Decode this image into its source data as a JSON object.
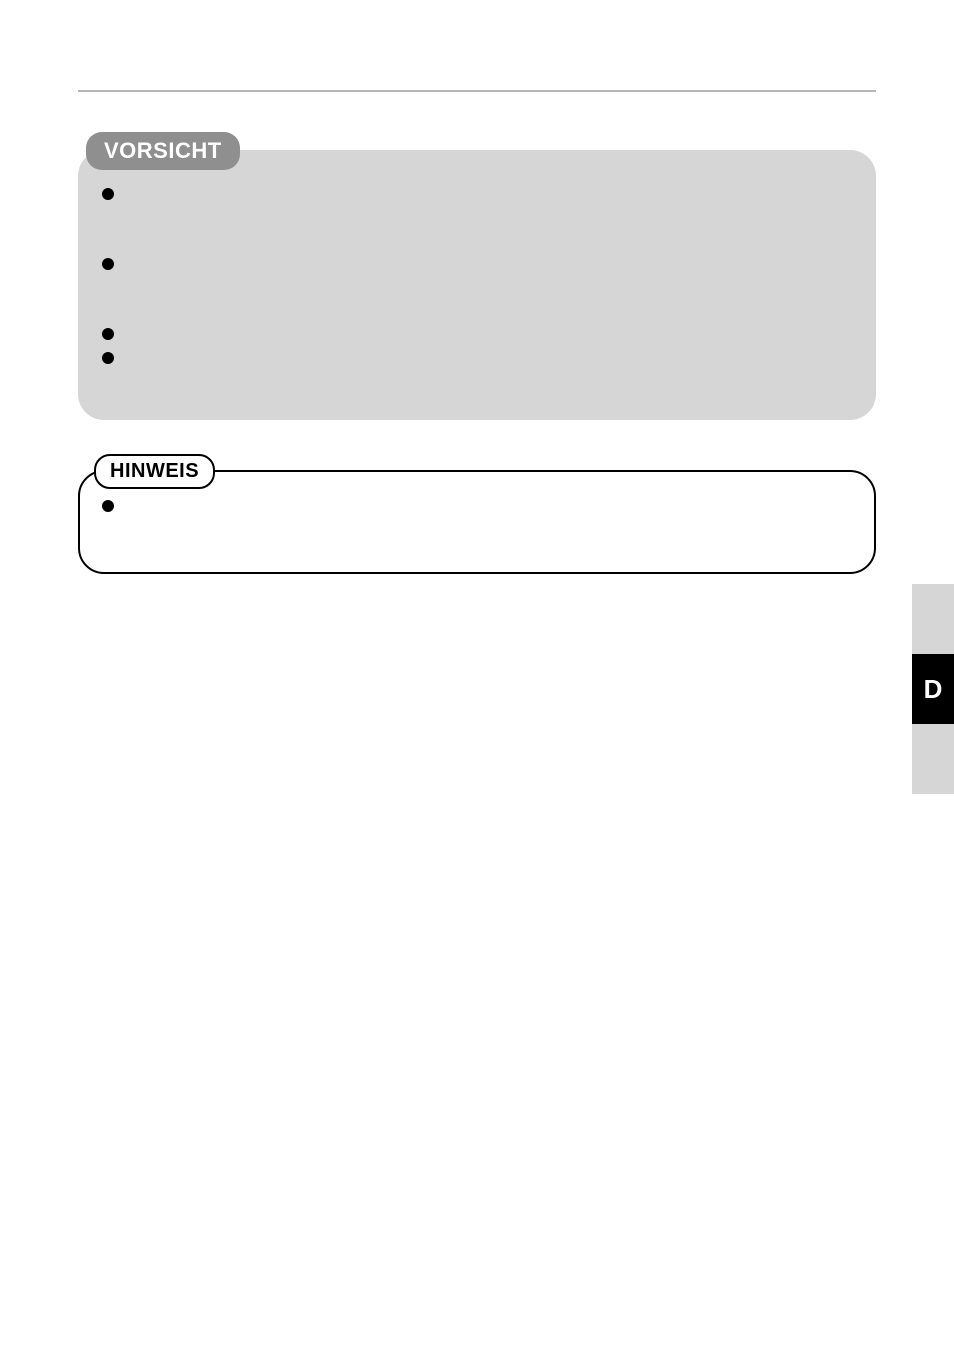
{
  "callouts": {
    "vorsicht": {
      "label": "VORSICHT",
      "bullets": [
        "",
        "",
        "",
        ""
      ]
    },
    "hinweis": {
      "label": "HINWEIS",
      "bullets": [
        ""
      ]
    }
  },
  "sideTab": {
    "activeLabel": "D"
  }
}
